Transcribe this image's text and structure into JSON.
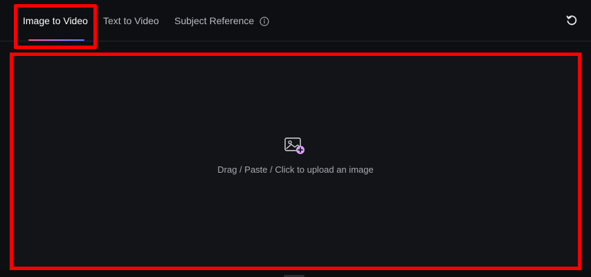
{
  "tabs": [
    {
      "label": "Image to Video",
      "active": true
    },
    {
      "label": "Text to Video",
      "active": false
    },
    {
      "label": "Subject Reference",
      "active": false
    }
  ],
  "icons": {
    "info": "info-icon",
    "reset": "reset-icon",
    "upload": "image-upload-icon"
  },
  "upload": {
    "instruction": "Drag / Paste / Click to upload an image"
  },
  "colors": {
    "background": "#0e0f12",
    "dropzone": "#131418",
    "highlight": "#ff0000",
    "upload_plus_accent": "#d8a0ff"
  }
}
